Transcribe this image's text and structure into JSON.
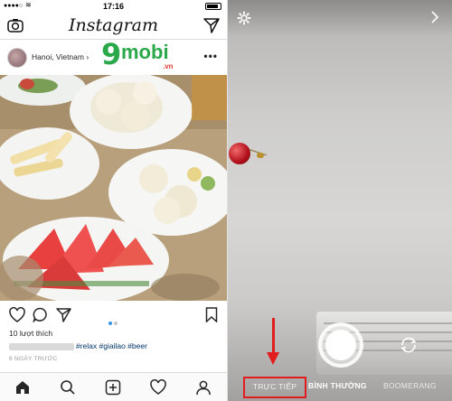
{
  "status_bar": {
    "time": "17:16"
  },
  "header": {
    "app_title": "Instagram"
  },
  "post": {
    "location": "Hanoi, Vietnam",
    "likes": "10 lượt thích",
    "caption_tags": "#relax #giailao #beer",
    "date": "6 NGÀY TRƯỚC"
  },
  "watermark": {
    "nine": "9",
    "mobi": "mobi",
    "vn": ".vn"
  },
  "camera": {
    "modes": {
      "live": "TRỰC TIẾP",
      "normal": "BÌNH THƯỜNG",
      "boomerang": "BOOMERANG"
    }
  },
  "colors": {
    "accent_red": "#e11d1d",
    "pager_active": "#3897f0",
    "watermark_green": "#2aa84a"
  },
  "icons": [
    "camera-icon",
    "direct-send-icon",
    "more-icon",
    "heart-icon",
    "comment-icon",
    "share-icon",
    "bookmark-icon",
    "home-icon",
    "search-icon",
    "add-post-icon",
    "activity-icon",
    "profile-icon",
    "settings-gear-icon",
    "chevron-right-icon",
    "flip-camera-icon"
  ]
}
